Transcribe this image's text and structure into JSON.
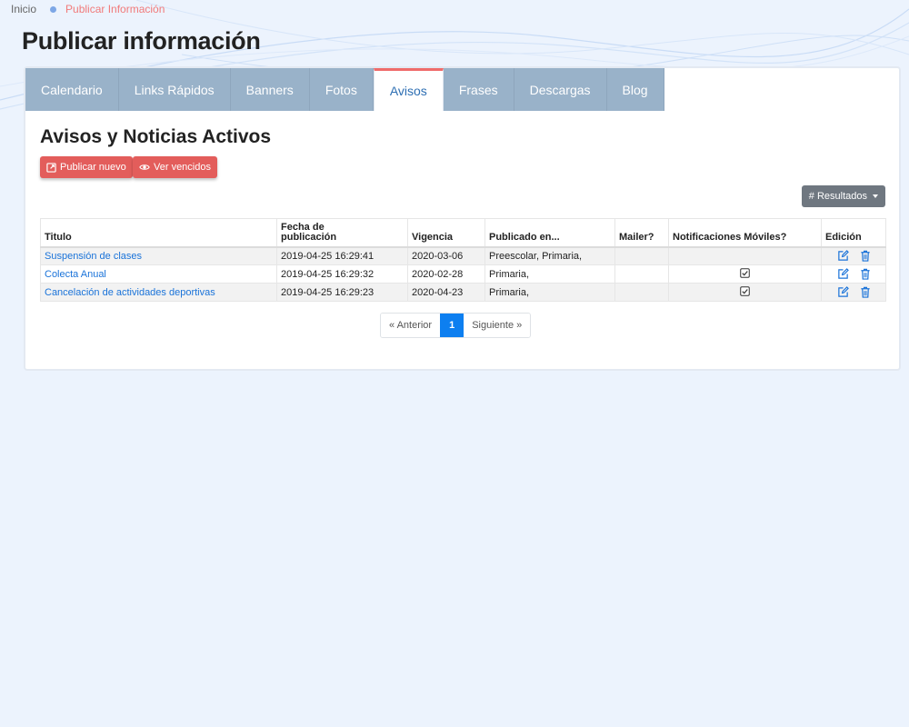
{
  "breadcrumb": {
    "home": "Inicio",
    "current": "Publicar Información"
  },
  "page": {
    "title": "Publicar información"
  },
  "tabs": [
    {
      "label": "Calendario",
      "active": false
    },
    {
      "label": "Links Rápidos",
      "active": false
    },
    {
      "label": "Banners",
      "active": false
    },
    {
      "label": "Fotos",
      "active": false
    },
    {
      "label": "Avisos",
      "active": true
    },
    {
      "label": "Frases",
      "active": false
    },
    {
      "label": "Descargas",
      "active": false
    },
    {
      "label": "Blog",
      "active": false
    }
  ],
  "section": {
    "title": "Avisos y Noticias Activos",
    "publish_label": "Publicar nuevo",
    "expired_label": "Ver vencidos",
    "results_label": "# Resultados"
  },
  "table": {
    "headers": {
      "title": "Titulo",
      "pub_date_line1": "Fecha de",
      "pub_date_line2": "publicación",
      "validity": "Vigencia",
      "published_in": "Publicado en...",
      "mailer": "Mailer?",
      "mobile": "Notificaciones Móviles?",
      "edit": "Edición"
    },
    "rows": [
      {
        "title": "Suspensión de clases",
        "pub_date": "2019-04-25 16:29:41",
        "validity": "2020-03-06",
        "published_in": "Preescolar, Primaria,",
        "mailer": false,
        "mobile": false
      },
      {
        "title": "Colecta Anual",
        "pub_date": "2019-04-25 16:29:32",
        "validity": "2020-02-28",
        "published_in": "Primaria,",
        "mailer": false,
        "mobile": true
      },
      {
        "title": "Cancelación de actividades deportivas",
        "pub_date": "2019-04-25 16:29:23",
        "validity": "2020-04-23",
        "published_in": "Primaria,",
        "mailer": false,
        "mobile": true
      }
    ]
  },
  "pagination": {
    "prev": "« Anterior",
    "current": "1",
    "next": "Siguiente »"
  },
  "colors": {
    "tab_bg": "#99b2c9",
    "accent_red": "#e35d5b",
    "link_blue": "#1a73d9",
    "page_blue": "#0d7ff0"
  }
}
